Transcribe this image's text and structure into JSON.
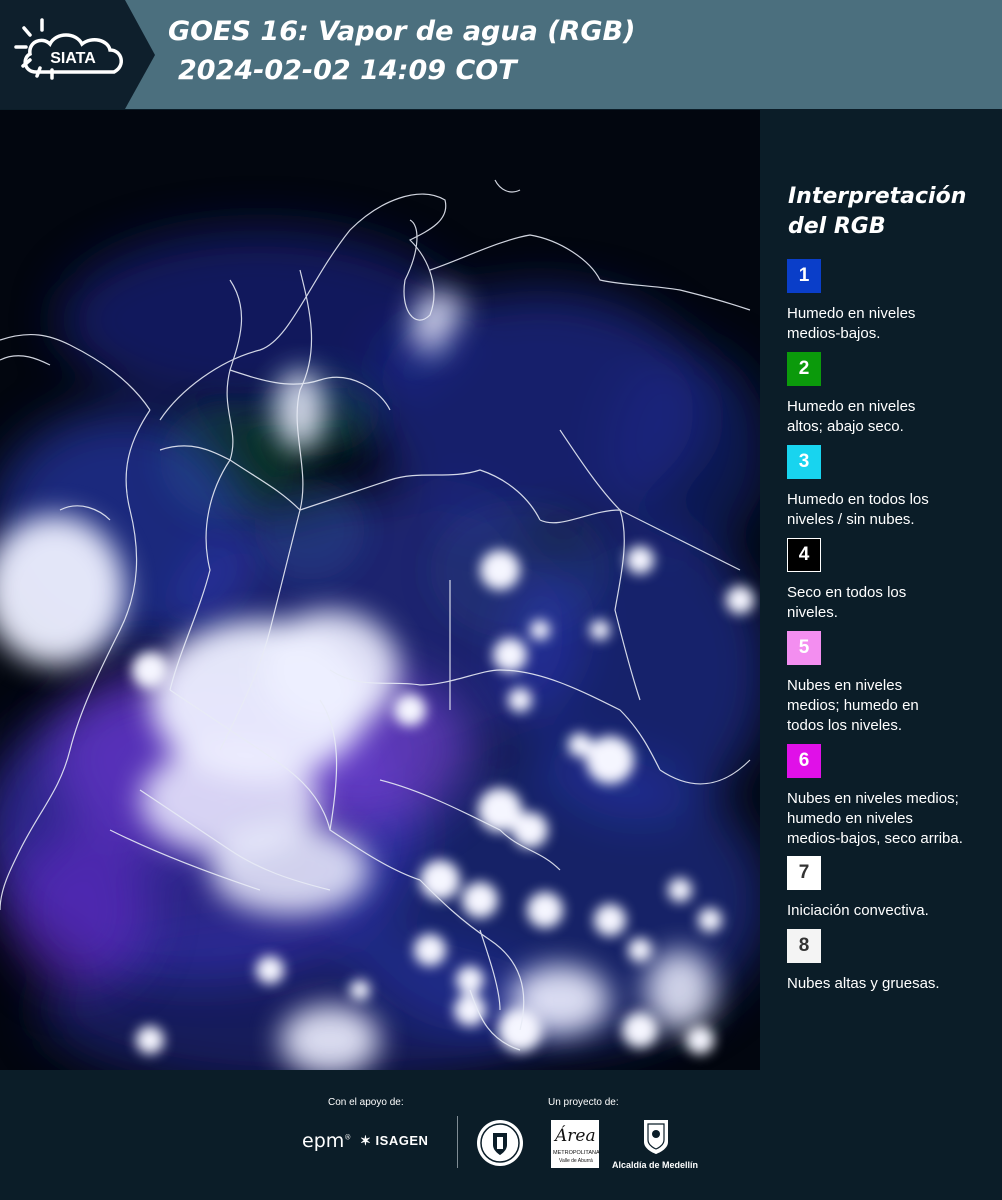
{
  "header": {
    "logo_text": "SIATA",
    "title_line1": "GOES 16: Vapor de agua (RGB)",
    "title_line2": "2024-02-02 14:09 COT",
    "bg_color": "#4b6f7e"
  },
  "legend": {
    "title_line1": "Interpretación",
    "title_line2": "del RGB",
    "items": [
      {
        "number": "1",
        "line1": "Humedo en niveles",
        "line2": "medios-bajos.",
        "line3": "",
        "color": "#0a3ec9",
        "text_color": "#ffffff"
      },
      {
        "number": "2",
        "line1": "Humedo en niveles",
        "line2": "altos; abajo seco.",
        "line3": "",
        "color": "#0b9a0b",
        "text_color": "#ffffff"
      },
      {
        "number": "3",
        "line1": "Humedo en todos los",
        "line2": "niveles / sin nubes.",
        "line3": "",
        "color": "#18d4ef",
        "text_color": "#ffffff"
      },
      {
        "number": "4",
        "line1": "Seco en todos los",
        "line2": "niveles.",
        "line3": "",
        "color": "#000000",
        "text_color": "#ffffff"
      },
      {
        "number": "5",
        "line1": "Nubes en niveles",
        "line2": "medios; humedo en",
        "line3": "todos los niveles.",
        "color": "#f38ef0",
        "text_color": "#ffffff"
      },
      {
        "number": "6",
        "line1": "Nubes en niveles medios;",
        "line2": "humedo en niveles",
        "line3": "medios-bajos, seco arriba.",
        "color": "#e010e8",
        "text_color": "#ffffff"
      },
      {
        "number": "7",
        "line1": "Iniciación convectiva.",
        "line2": "",
        "line3": "",
        "color": "#ffffff",
        "text_color": "#333333"
      },
      {
        "number": "8",
        "line1": "Nubes altas y gruesas.",
        "line2": "",
        "line3": "",
        "color": "#f4f4f4",
        "text_color": "#333333"
      }
    ]
  },
  "footer": {
    "support_label": "Con el apoyo de:",
    "project_label": "Un proyecto de:",
    "logo_epm": "epm",
    "logo_isagen": "ISAGEN",
    "logo_area_main": "Área",
    "logo_area_sub1": "METROPOLITANA",
    "logo_area_sub2": "Valle de Aburrá",
    "logo_medellin_text": "Alcaldía de Medellín"
  }
}
